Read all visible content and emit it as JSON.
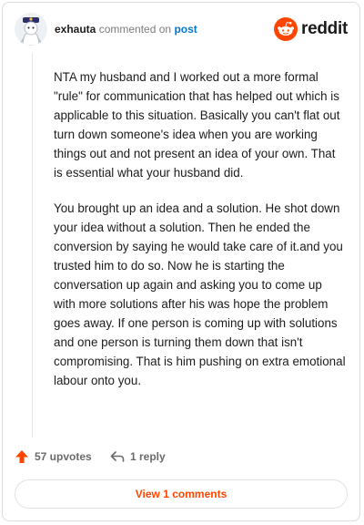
{
  "header": {
    "username": "exhauta",
    "commented_on": "commented on",
    "post_link": "post",
    "logo_text": "reddit"
  },
  "comment": {
    "paragraphs": [
      "NTA my husband and I worked out a more formal \"rule\" for communication that has helped out which is applicable to this situation. Basically you can't flat out turn down someone's idea when you are working things out and not present an idea of your own. That is essential what your husband did.",
      "You brought up an idea and a solution. He shot down your idea without a solution. Then he ended the conversion by saying he would take care of it.and you trusted him to do so. Now he is starting the conversation up again and asking you to come up with more solutions after his was hope the problem goes away. If one person is coming up with solutions and one person is turning them down that isn't compromising. That is him pushing on extra emotional labour onto you."
    ]
  },
  "footer": {
    "upvotes_label": "57 upvotes",
    "replies_label": "1 reply",
    "view_comments_label": "View 1 comments"
  },
  "colors": {
    "accent": "#ff4500",
    "link": "#0079d3"
  },
  "icons": {
    "upvote": "upvote-arrow-icon",
    "reply": "reply-arrow-icon",
    "logo": "reddit-snoo-icon",
    "avatar": "user-avatar"
  }
}
